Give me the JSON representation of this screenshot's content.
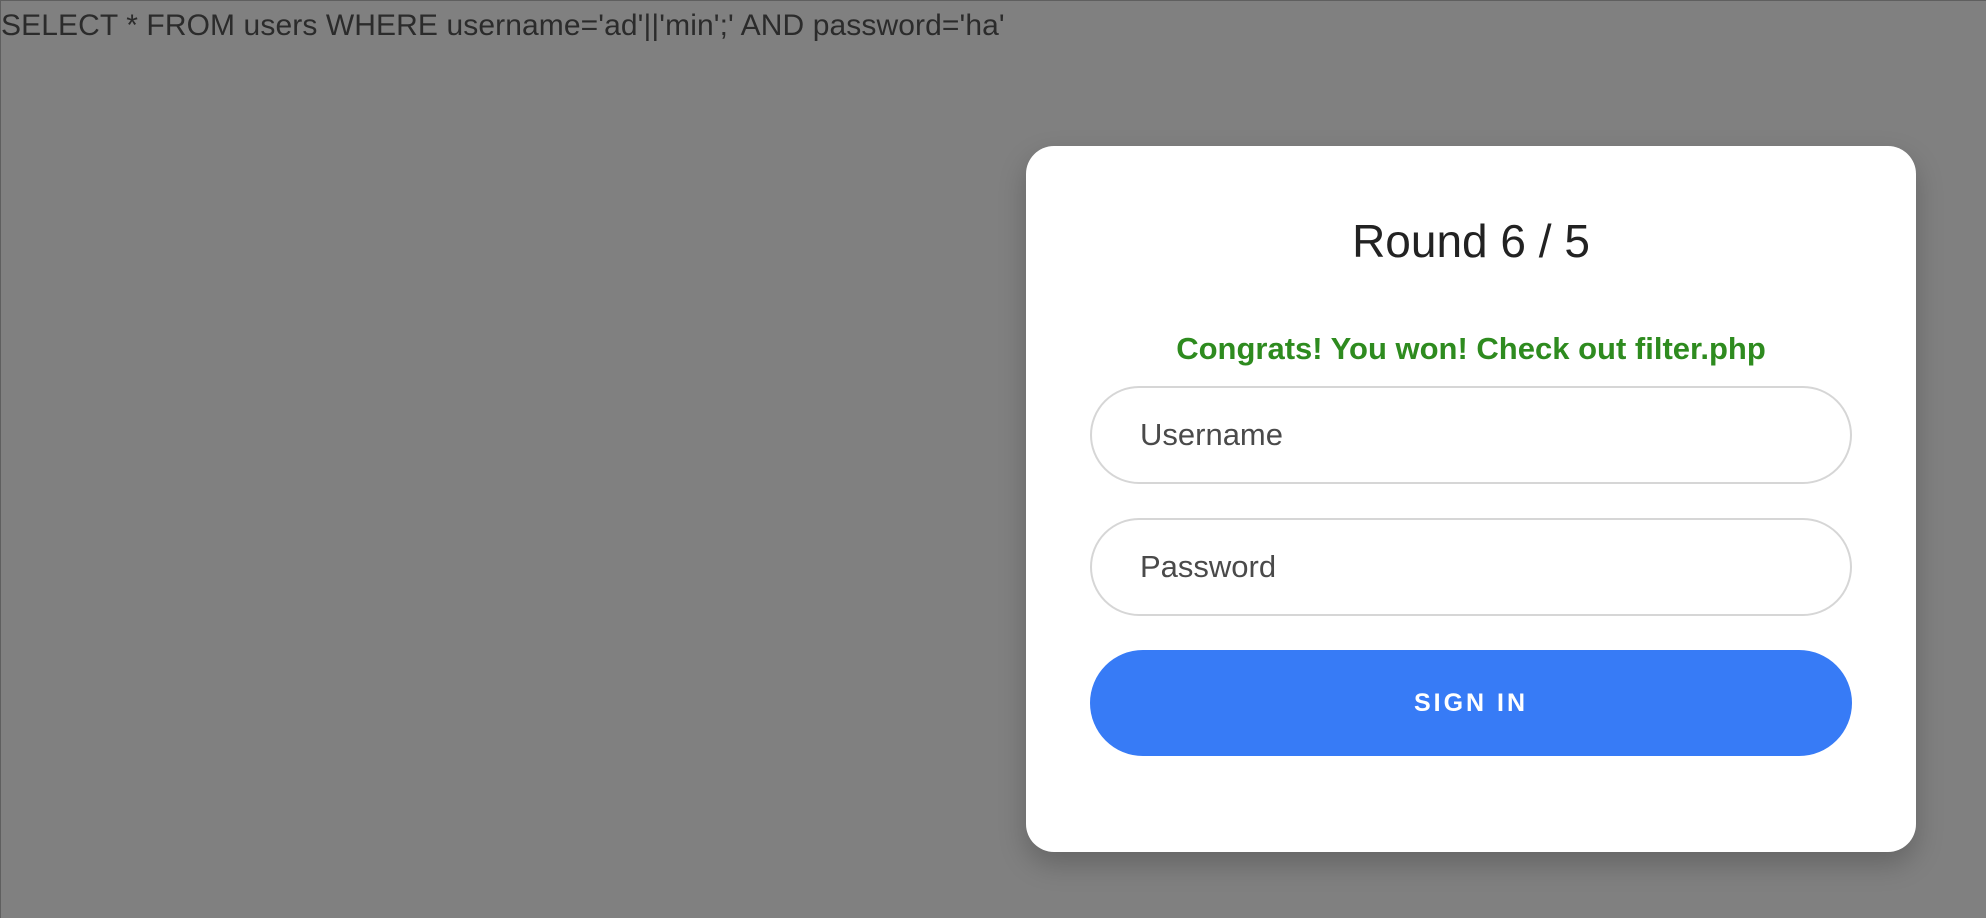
{
  "query": {
    "text": "SELECT * FROM users WHERE username='ad'||'min';' AND password='ha'"
  },
  "login_card": {
    "title": "Round 6 / 5",
    "message": "Congrats! You won! Check out filter.php",
    "username_placeholder": "Username",
    "password_placeholder": "Password",
    "signin_label": "SIGN IN"
  },
  "colors": {
    "background": "#808080",
    "card": "#ffffff",
    "success_text": "#2e8b1f",
    "button": "#377bf6"
  }
}
